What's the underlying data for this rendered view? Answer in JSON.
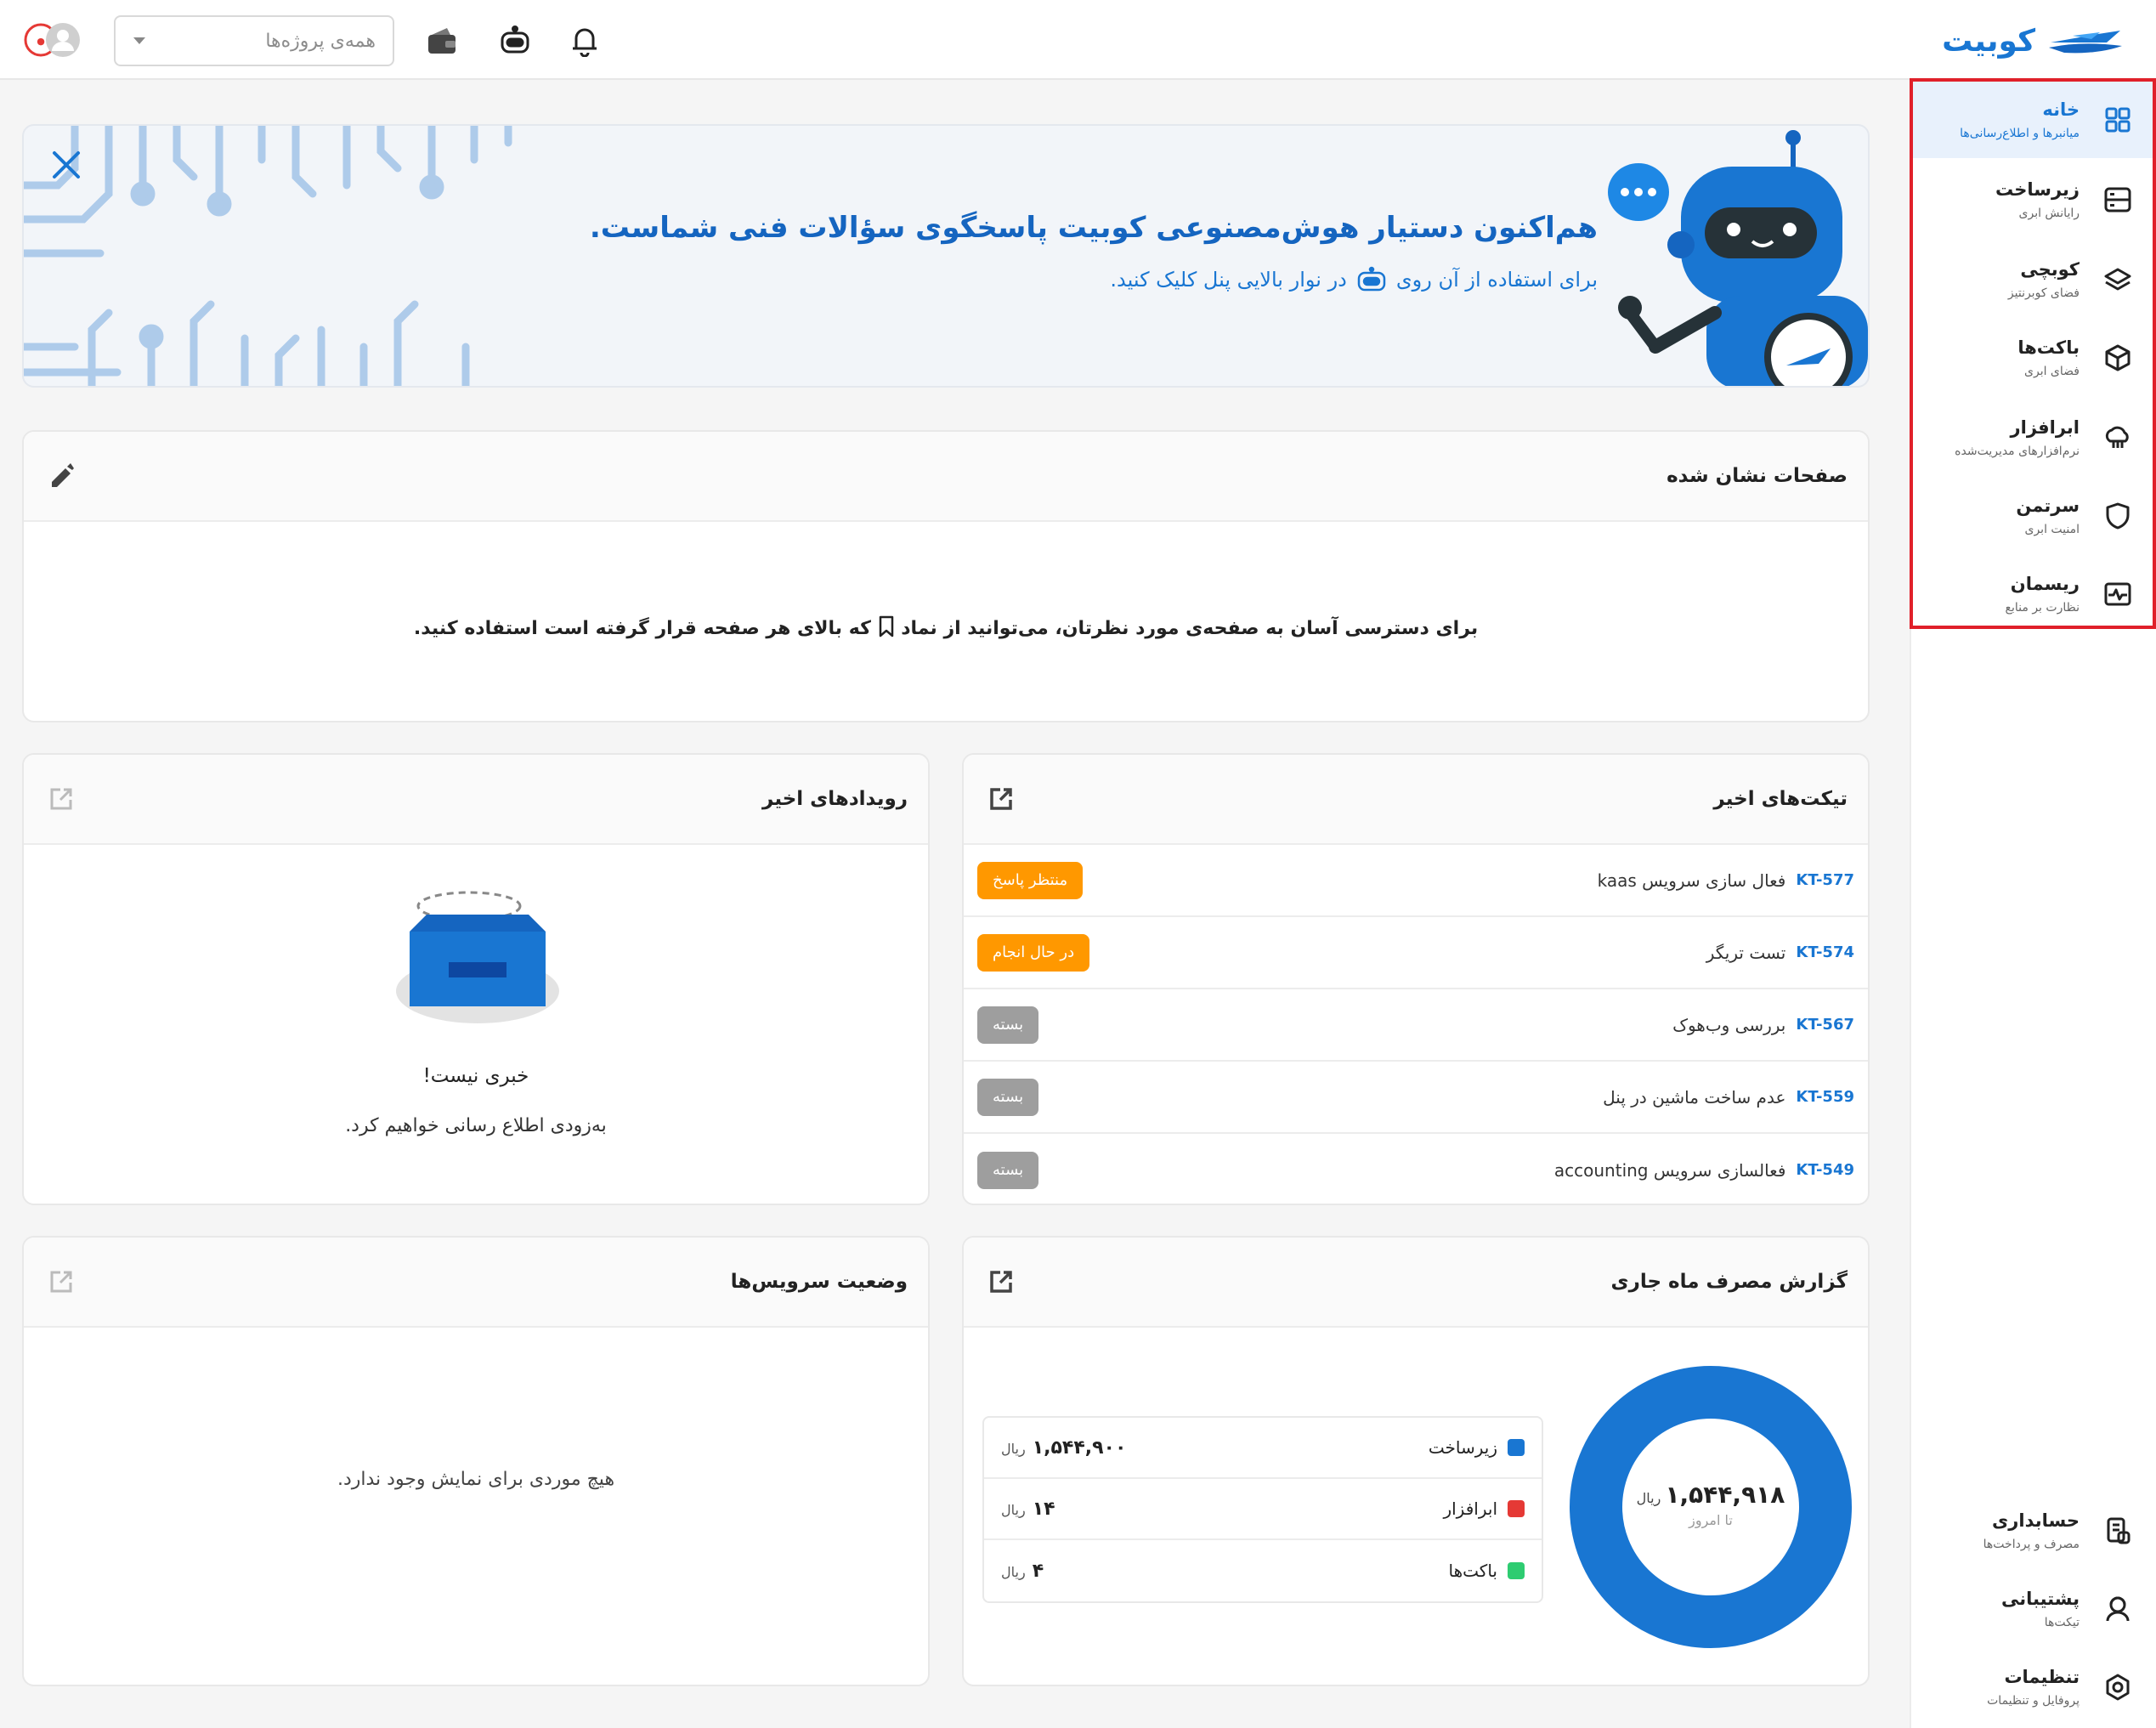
{
  "app": {
    "logo_text": "کوبیت"
  },
  "topbar": {
    "project_placeholder": "همه‌ی پروژه‌ها"
  },
  "sidebar": {
    "items": [
      {
        "label": "خانه",
        "sub": "میانبرها و اطلاع‌رسانی‌ها",
        "icon": "dashboard-grid-icon",
        "active": true
      },
      {
        "label": "زیرساخت",
        "sub": "رایانش ابری",
        "icon": "server-icon"
      },
      {
        "label": "کوبچی",
        "sub": "فضای کوبرنتیز",
        "icon": "layers-icon"
      },
      {
        "label": "باکت‌ها",
        "sub": "فضای ابری",
        "icon": "cube-icon"
      },
      {
        "label": "ابرافزار",
        "sub": "نرم‌افزارهای مدیریت‌شده",
        "icon": "cloud-tree-icon"
      },
      {
        "label": "سرتمن",
        "sub": "امنیت ابری",
        "icon": "shield-icon"
      },
      {
        "label": "ریسمان",
        "sub": "نظارت بر منابع",
        "icon": "monitor-pulse-icon"
      }
    ],
    "bottom_items": [
      {
        "label": "حسابداری",
        "sub": "مصرف و پرداخت‌ها",
        "icon": "billing-icon"
      },
      {
        "label": "پشتیبانی",
        "sub": "تیکت‌ها",
        "icon": "support-icon"
      },
      {
        "label": "تنظیمات",
        "sub": "پروفایل و تنظیمات",
        "icon": "settings-icon"
      }
    ],
    "active_color": "#1976d2",
    "highlight_color": "#e0202a"
  },
  "banner": {
    "title": "هم‌اکنون دستیار هوش‌مصنوعی کوبیت پاسخگوی سؤالات فنی شماست.",
    "sub_before": "برای استفاده از آن روی",
    "sub_after": "در نوار بالایی پنل کلیک کنید."
  },
  "bookmarks": {
    "title": "صفحات نشان شده",
    "text_before": "برای دسترسی آسان به صفحه‌ی مورد نظرتان، می‌توانید از نماد",
    "text_after": "که بالای هر صفحه قرار گرفته است استفاده کنید."
  },
  "events": {
    "title": "رویدادهای اخیر",
    "empty_title": "خبری نیست!",
    "empty_sub": "به‌زودی اطلاع رسانی خواهیم کرد."
  },
  "tickets": {
    "title": "تیکت‌های اخیر",
    "rows": [
      {
        "id": "KT-577",
        "title": "فعال سازی سرویس kaas",
        "status": "منتظر پاسخ",
        "color": "#ff9800"
      },
      {
        "id": "KT-574",
        "title": "تست تریگر",
        "status": "در حال انجام",
        "color": "#ff9800"
      },
      {
        "id": "KT-567",
        "title": "بررسی وب‌هوک",
        "status": "بسته",
        "color": "#9e9e9e"
      },
      {
        "id": "KT-559",
        "title": "عدم ساخت ماشین در پنل",
        "status": "بسته",
        "color": "#9e9e9e"
      },
      {
        "id": "KT-549",
        "title": "فعالسازی سرویس accounting",
        "status": "بسته",
        "color": "#9e9e9e"
      }
    ]
  },
  "services": {
    "title": "وضعیت سرویس‌ها",
    "empty": "هیچ موردی برای نمایش وجود ندارد."
  },
  "usage": {
    "title": "گزارش مصرف ماه جاری",
    "total": "۱,۵۴۴,۹۱۸",
    "total_unit": "ریال",
    "total_caption": "تا امروز",
    "unit": "ریال",
    "rows": [
      {
        "name": "زیرساخت",
        "value": "۱,۵۴۴,۹۰۰",
        "color": "#1976d2"
      },
      {
        "name": "ابرافزار",
        "value": "۱۴",
        "color": "#e53935"
      },
      {
        "name": "باکت‌ها",
        "value": "۴",
        "color": "#2ecc71"
      }
    ],
    "donut_color": "#1976d2"
  }
}
